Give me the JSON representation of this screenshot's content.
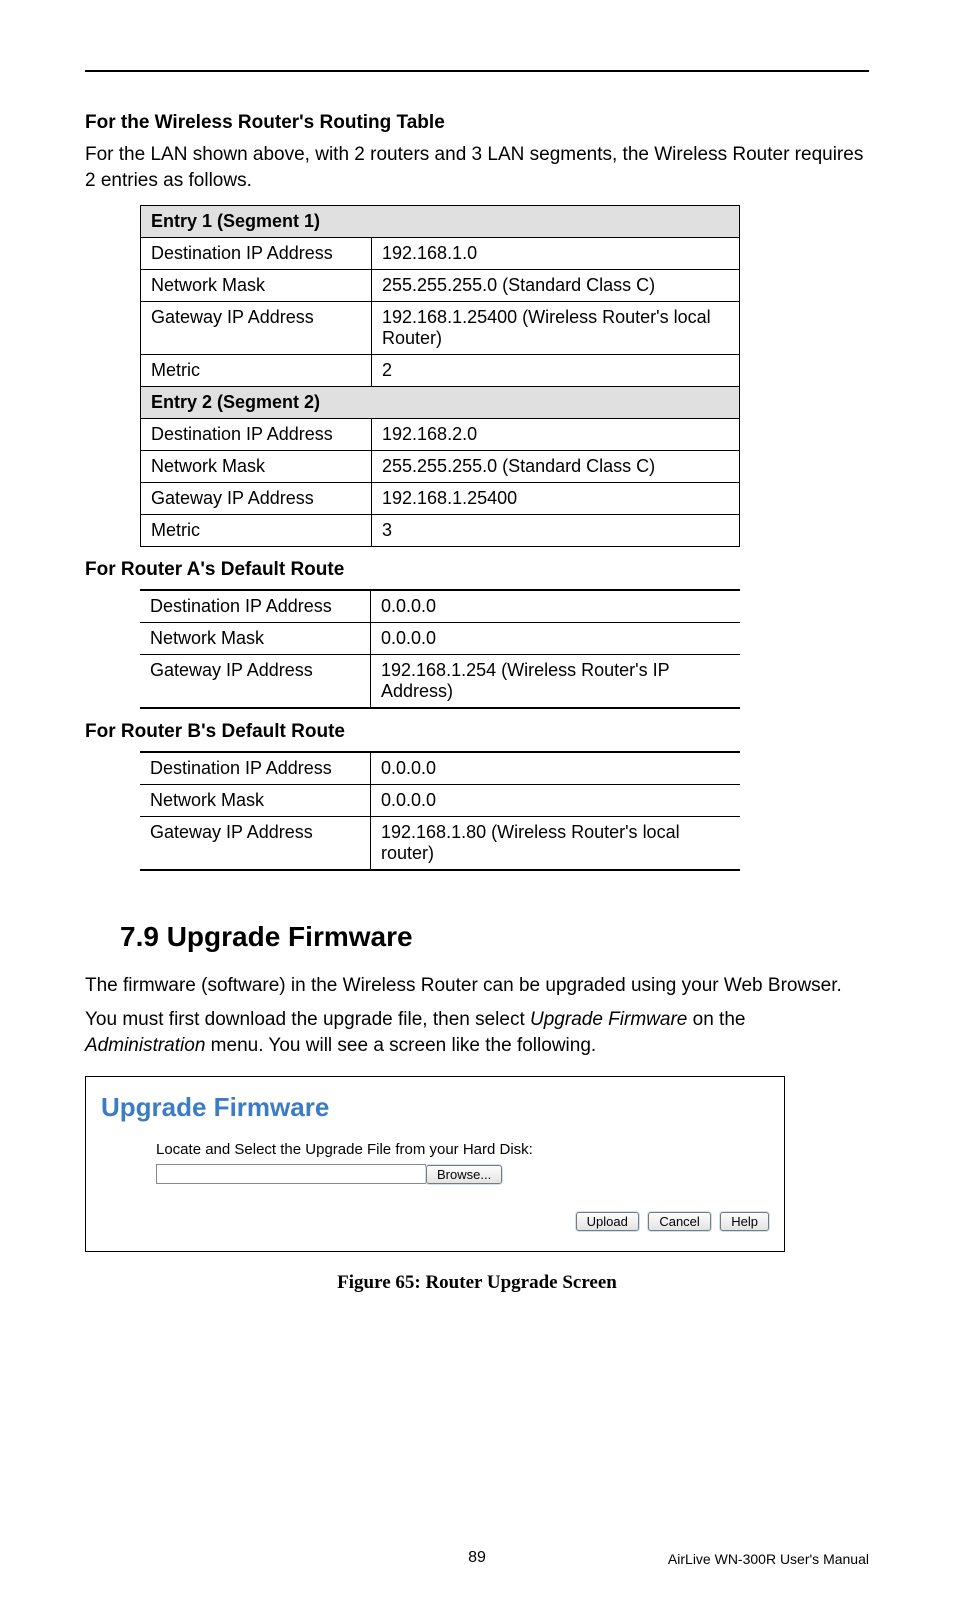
{
  "section1": {
    "title": "For the Wireless Router's Routing Table",
    "paragraph": "For the LAN shown above, with 2 routers and 3 LAN segments, the Wireless Router requires 2 entries as follows."
  },
  "routingTable": {
    "entry1Header": "Entry 1 (Segment 1)",
    "entry1": {
      "destLabel": "Destination IP Address",
      "destValue": "192.168.1.0",
      "maskLabel": "Network Mask",
      "maskValue": "255.255.255.0  (Standard Class C)",
      "gatewayLabel": "Gateway IP Address",
      "gatewayValue": "192.168.1.25400  (Wireless Router's local Router)",
      "metricLabel": "Metric",
      "metricValue": "2"
    },
    "entry2Header": "Entry 2 (Segment 2)",
    "entry2": {
      "destLabel": "Destination IP Address",
      "destValue": "192.168.2.0",
      "maskLabel": "Network Mask",
      "maskValue": "255.255.255.0  (Standard Class C)",
      "gatewayLabel": "Gateway IP Address",
      "gatewayValue": "192.168.1.25400",
      "metricLabel": "Metric",
      "metricValue": "3"
    }
  },
  "routerA": {
    "title": "For Router A's Default Route",
    "destLabel": "Destination IP Address",
    "destValue": "0.0.0.0",
    "maskLabel": "Network Mask",
    "maskValue": "0.0.0.0",
    "gatewayLabel": "Gateway IP Address",
    "gatewayValue": "192.168.1.254  (Wireless Router's IP Address)"
  },
  "routerB": {
    "title": "For Router B's Default Route",
    "destLabel": "Destination IP Address",
    "destValue": "0.0.0.0",
    "maskLabel": "Network Mask",
    "maskValue": "0.0.0.0",
    "gatewayLabel": "Gateway IP Address",
    "gatewayValue": "192.168.1.80 (Wireless Router's local router)"
  },
  "upgradeSection": {
    "heading": "7.9  Upgrade Firmware",
    "para1": "The firmware (software) in the Wireless Router can be upgraded using your Web Browser.",
    "para2a": "You must first download the upgrade file, then select ",
    "para2b": "Upgrade Firmware",
    "para2c": " on the ",
    "para2d": "Administration",
    "para2e": " menu. You will see a screen like the following."
  },
  "firmwareScreen": {
    "title": "Upgrade Firmware",
    "label": "Locate and Select the Upgrade File from your Hard Disk:",
    "browseBtn": "Browse...",
    "uploadBtn": "Upload",
    "cancelBtn": "Cancel",
    "helpBtn": "Help"
  },
  "figureCaption": "Figure 65: Router Upgrade Screen",
  "footer": {
    "pageNumber": "89",
    "manualName": "AirLive WN-300R User's Manual"
  }
}
